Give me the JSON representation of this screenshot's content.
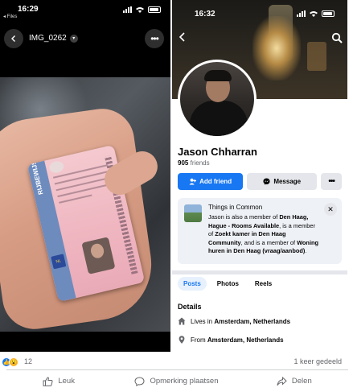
{
  "left_phone": {
    "status_time": "16:29",
    "back_app_label": "◂ Files",
    "photo_title": "IMG_0262",
    "card_band_text": "RIJBEWIJS",
    "card_eu_label": "NL"
  },
  "right_phone": {
    "status_time": "16:32",
    "profile_name": "Jason Chharran",
    "friends_count": "905",
    "friends_label": "friends",
    "add_friend_label": "Add friend",
    "message_label": "Message",
    "common": {
      "title": "Things in Common",
      "part1": "Jason is also a member of ",
      "group1": "Den Haag, Hague - Rooms Available",
      "part2": ", is a member of ",
      "group2": "Zoekt kamer in Den Haag Community",
      "part3": ", and is a member of ",
      "group3": "Woning huren in Den Haag (vraag/aanbod)",
      "part4": "."
    },
    "tabs": [
      "Posts",
      "Photos",
      "Reels"
    ],
    "details_title": "Details",
    "lives_prefix": "Lives in ",
    "lives_value": "Amsterdam, Netherlands",
    "from_prefix": "From ",
    "from_value": "Amsterdam, Netherlands"
  },
  "post_footer": {
    "reaction_count": "12",
    "share_count": "1 keer gedeeld",
    "like_label": "Leuk",
    "comment_label": "Opmerking plaatsen",
    "share_label": "Delen"
  },
  "colors": {
    "facebook_blue": "#1877f2",
    "secondary_button": "#e4e6eb",
    "muted_text": "#65676b"
  },
  "icons": [
    "back-icon",
    "chevron-down-icon",
    "more-icon",
    "search-icon",
    "add-person-icon",
    "messenger-icon",
    "close-icon",
    "home-icon",
    "location-pin-icon",
    "like-icon",
    "comment-icon",
    "share-icon"
  ]
}
